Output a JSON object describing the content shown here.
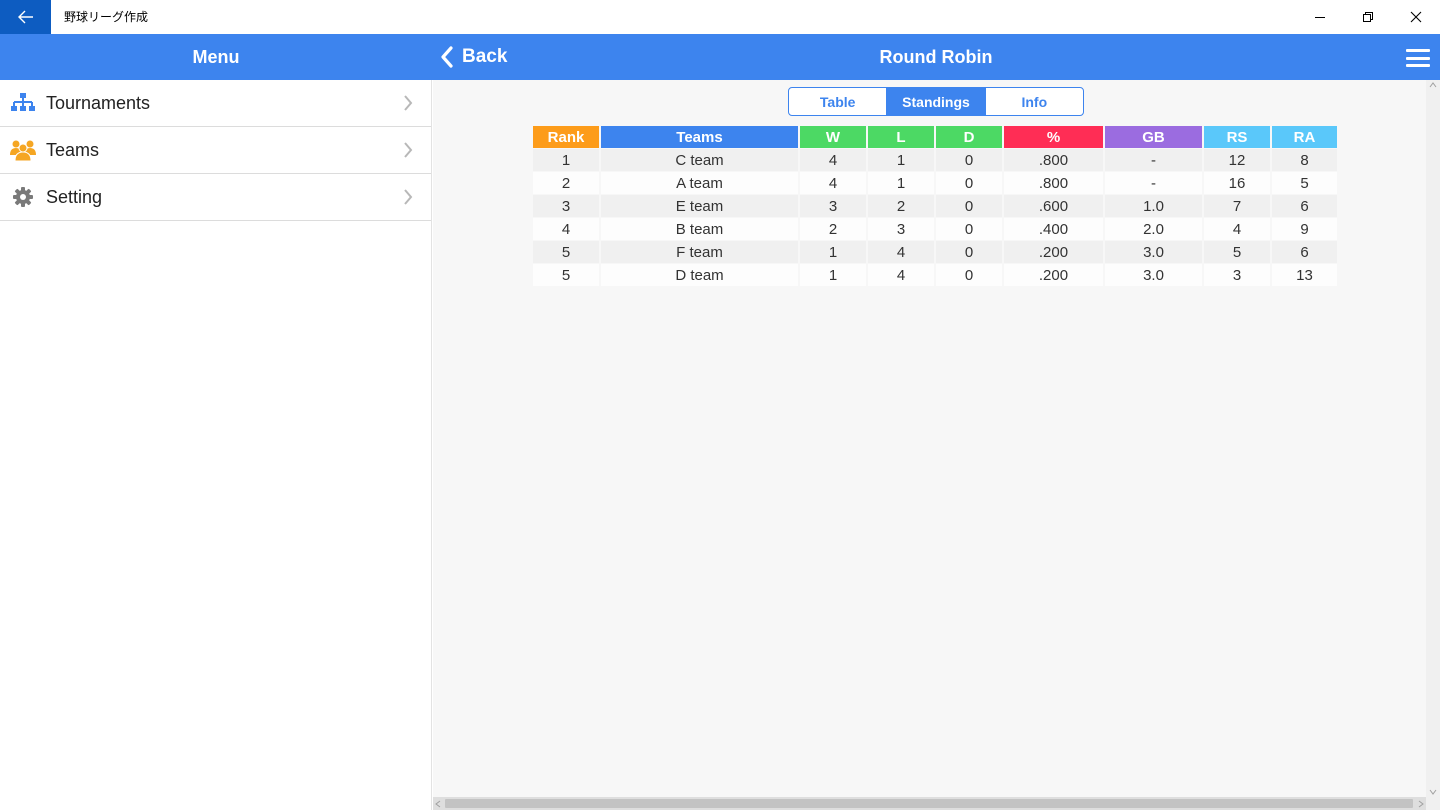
{
  "window": {
    "title": "野球リーグ作成"
  },
  "appbar": {
    "menu_label": "Menu",
    "back_label": "Back",
    "page_title": "Round Robin"
  },
  "sidebar": {
    "items": [
      {
        "label": "Tournaments",
        "icon": "tournament-icon"
      },
      {
        "label": "Teams",
        "icon": "teams-icon"
      },
      {
        "label": "Setting",
        "icon": "gear-icon"
      }
    ]
  },
  "tabs": [
    {
      "label": "Table",
      "active": false
    },
    {
      "label": "Standings",
      "active": true
    },
    {
      "label": "Info",
      "active": false
    }
  ],
  "colors": {
    "accent": "#3d84ee",
    "titlebar_back": "#0d5cc1"
  },
  "standings": {
    "headers": [
      {
        "label": "Rank",
        "color": "#fd9c1a"
      },
      {
        "label": "Teams",
        "color": "#3d84ee"
      },
      {
        "label": "W",
        "color": "#4cd964"
      },
      {
        "label": "L",
        "color": "#4cd964"
      },
      {
        "label": "D",
        "color": "#4cd964"
      },
      {
        "label": "%",
        "color": "#ff2d55"
      },
      {
        "label": "GB",
        "color": "#9b6ce0"
      },
      {
        "label": "RS",
        "color": "#5ac8fa"
      },
      {
        "label": "RA",
        "color": "#5ac8fa"
      }
    ],
    "rows": [
      [
        "1",
        "C team",
        "4",
        "1",
        "0",
        ".800",
        "-",
        "12",
        "8"
      ],
      [
        "2",
        "A team",
        "4",
        "1",
        "0",
        ".800",
        "-",
        "16",
        "5"
      ],
      [
        "3",
        "E team",
        "3",
        "2",
        "0",
        ".600",
        "1.0",
        "7",
        "6"
      ],
      [
        "4",
        "B team",
        "2",
        "3",
        "0",
        ".400",
        "2.0",
        "4",
        "9"
      ],
      [
        "5",
        "F team",
        "1",
        "4",
        "0",
        ".200",
        "3.0",
        "5",
        "6"
      ],
      [
        "5",
        "D team",
        "1",
        "4",
        "0",
        ".200",
        "3.0",
        "3",
        "13"
      ]
    ]
  }
}
